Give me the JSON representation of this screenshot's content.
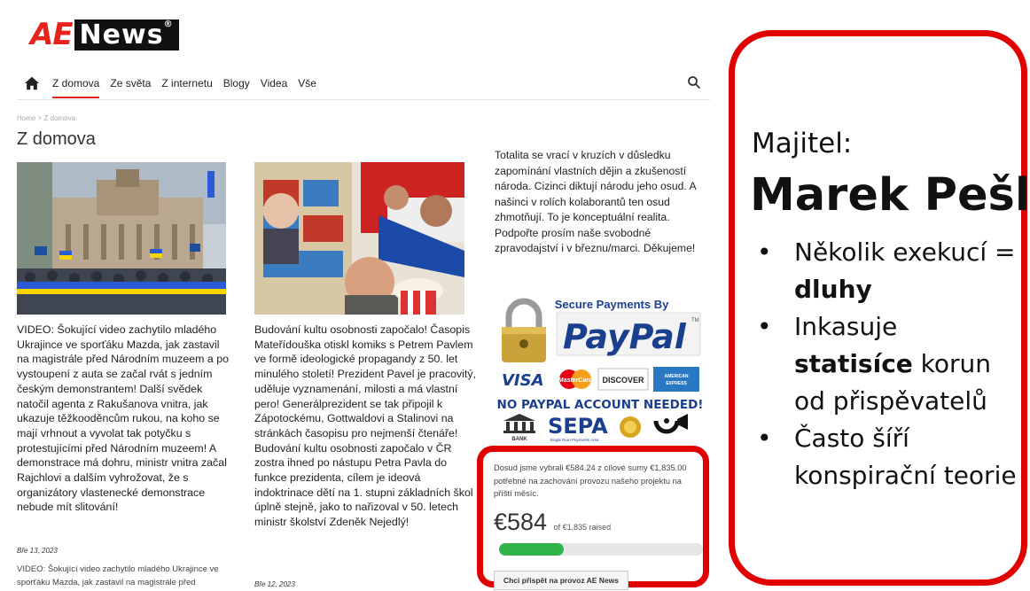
{
  "site": {
    "logo_ae": "AE",
    "logo_news": "News",
    "logo_reg": "®"
  },
  "nav": {
    "items": [
      "Z domova",
      "Ze světa",
      "Z internetu",
      "Blogy",
      "Videa",
      "Vše"
    ],
    "active": "Z domova"
  },
  "breadcrumb": "Home > Z domova",
  "page_title": "Z domova",
  "article1": {
    "text": "VIDEO: Šokující video zachytilo mladého Ukrajince ve sporťáku Mazda, jak zastavil na magistrále před Národním muzeem a po vystoupení z auta se začal rvát s jedním českým demonstrantem! Další svědek natočil agenta z Rakušanova vnitra, jak ukazuje těžkooděncům rukou, na koho se mají vrhnout a vyvolat tak potyčku s protestujícími před Národním muzeem! A demonstrace má dohru, ministr vnitra začal Rajchlovi a dalším vyhrožovat, že s organizátory vlastenecké demonstrace nebude mít slitování!",
    "date": "Bře 13, 2023",
    "excerpt": "VIDEO: Šokující video zachytilo mladého Ukrajince ve sporťáku Mazda, jak zastavil na magistrále před"
  },
  "article2": {
    "text": "Budování kultu osobnosti započalo! Časopis Mateřídouška otiskl komiks s Petrem Pavlem ve formě ideologické propagandy z 50. let minulého století! Prezident Pavel je pracovitý, uděluje vyznamenání, milosti a má vlastní pero! Generálprezident se tak připojil k Zápotockému, Gottwaldovi a Stalinovi na stránkách časopisu pro nejmenší čtenáře! Budování kultu osobnosti započalo v ČR zostra ihned po nástupu Petra Pavla do funkce prezidenta, cílem je ideová indoktrinace dětí na 1. stupni základních škol úplně stejně, jako to nařizoval v 50. letech ministr školství Zdeněk Nejedlý!",
    "date": "Bře 12, 2023"
  },
  "sidebar": {
    "text": "Totalita se vrací v kruzích v důsledku zapomínání vlastních dějin a zkušeností národa. Cizinci diktují národu jeho osud. A našinci v rolích kolaborantů ten osud zhmotňují. To je konceptuální realita. Podpořte prosím naše svobodné zpravodajství i v březnu/marci. Děkujeme!"
  },
  "paypal": {
    "secure": "Secure Payments By",
    "brand": "PayPal",
    "tm": "TM",
    "cards": [
      "VISA",
      "MasterCard",
      "DISCOVER",
      "AMERICAN EXPRESS"
    ],
    "no_account": "NO PAYPAL ACCOUNT NEEDED!",
    "bank": "BANK",
    "sepa": "SEPA",
    "sepa_sub": "Single Euro Payments Area"
  },
  "donation": {
    "text": "Dosud jsme vybrali €584.24 z cílové sumy €1,835.00 potřebné na zachování provozu našeho projektu na příští měsíc.",
    "amount": "€584",
    "of": "of €1,835 raised",
    "progress": 0.318,
    "button": "Chci přispět na provoz AE News"
  },
  "panel": {
    "label": "Majitel:",
    "owner": "Marek Pešl",
    "b1_pre": "Několik exekucí = ",
    "b1_bold": "dluhy",
    "b2_pre": "Inkasuje ",
    "b2_bold": "statisíce",
    "b2_post": " korun od přispěvatelů",
    "b3": "Často šíří konspirační teorie"
  },
  "colors": {
    "accent": "#e10000",
    "progress": "#2fb34a",
    "paypal_blue": "#1a3f8f"
  }
}
